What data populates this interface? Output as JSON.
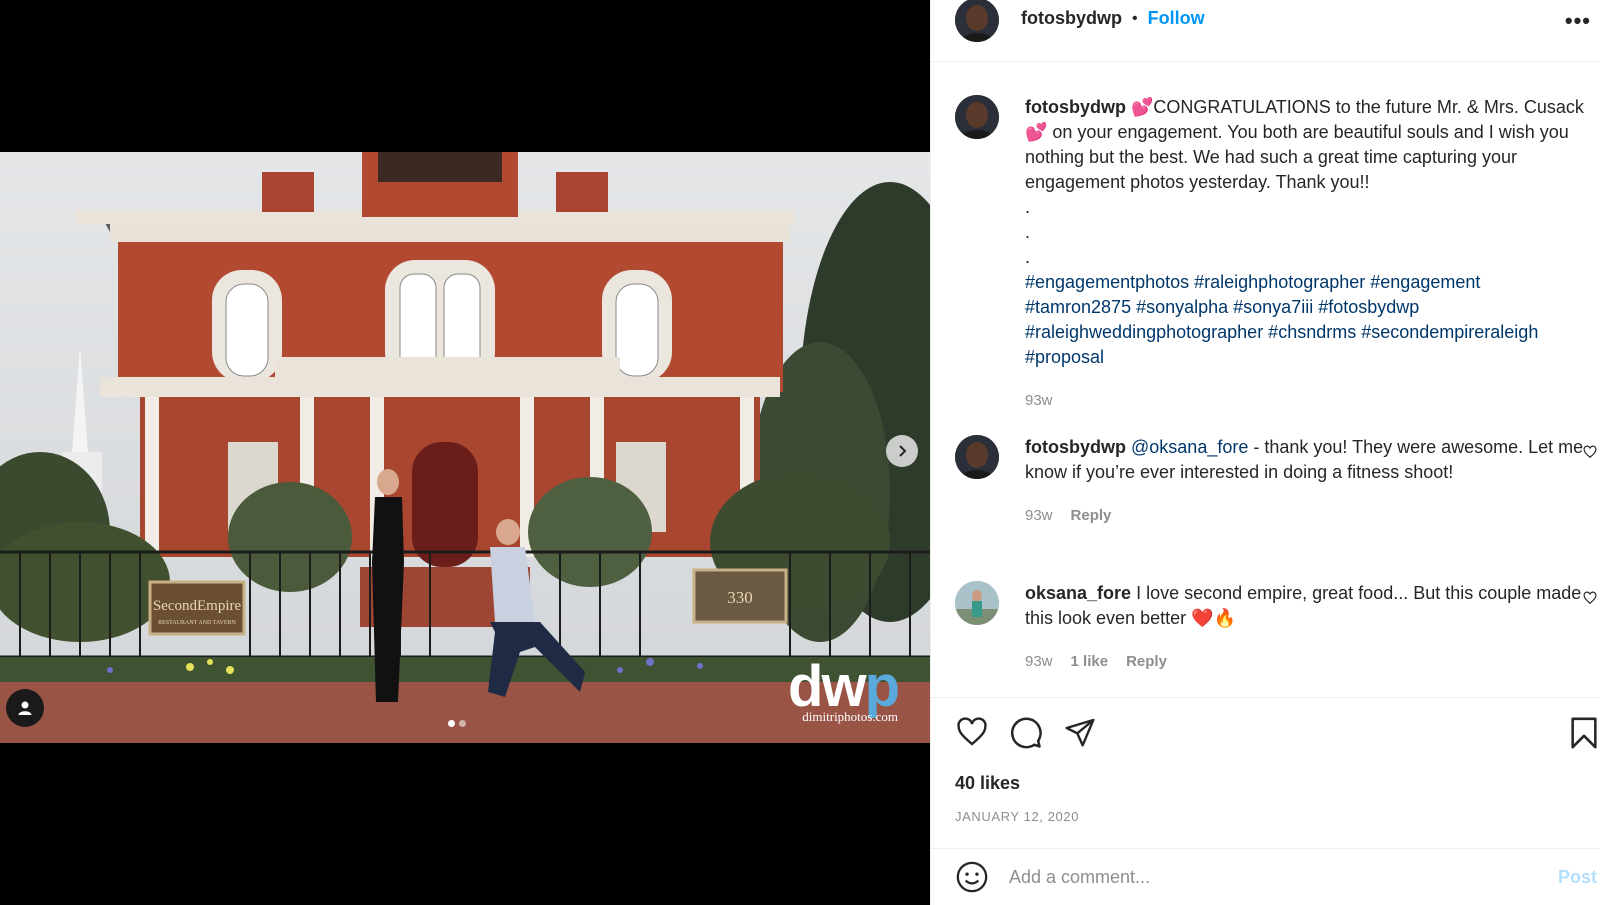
{
  "post": {
    "username": "fotosbydwp",
    "follow_label": "Follow",
    "separator": "•",
    "more_label": "•••",
    "caption": {
      "username": "fotosbydwp",
      "text_part1": " 💕CONGRATULATIONS to the future Mr. & Mrs. Cusack💕 on your engagement. You both are beautiful souls and I wish you nothing but the best. We had such a great time capturing your engagement photos yesterday. Thank you!!",
      "dots": [
        ".",
        ".",
        "."
      ],
      "hashtags": "#engagementphotos #raleighphotographer #engagement #tamron2875 #sonyalpha #sonya7iii #fotosbydwp #raleighweddingphotographer #chsndrms #secondempireraleigh #proposal",
      "time": "93w"
    },
    "comments": [
      {
        "username": "fotosbydwp",
        "mention": "@oksana_fore",
        "text": " - thank you! They were awesome. Let me know if you’re ever interested in doing a fitness shoot!",
        "time": "93w",
        "likes": "",
        "reply": "Reply"
      },
      {
        "username": "oksana_fore",
        "mention": "",
        "text": " I love second empire, great food... But this couple made this look even better ❤️🔥",
        "time": "93w",
        "likes": "1 like",
        "reply": "Reply"
      }
    ],
    "likes_label": "40 likes",
    "date": "JANUARY 12, 2020",
    "add_comment_placeholder": "Add a comment...",
    "post_label": "Post"
  },
  "media": {
    "watermark_logo": "dw",
    "watermark_logo_p": "p",
    "watermark_url": "dimitriphotos.com",
    "sign_left": "SecondEmpire",
    "sign_left_sub": "RESTAURANT AND TAVERN",
    "sign_right": "330",
    "carousel_count": 2,
    "carousel_active": 1
  },
  "colors": {
    "accent": "#0095f6",
    "link": "#00376b",
    "muted": "#8e8e8e",
    "post_disabled": "#b2dffc"
  },
  "icons": [
    "chevron-right-icon",
    "user-tag-icon",
    "heart-icon",
    "comment-icon",
    "share-icon",
    "bookmark-icon",
    "emoji-icon",
    "more-icon"
  ]
}
